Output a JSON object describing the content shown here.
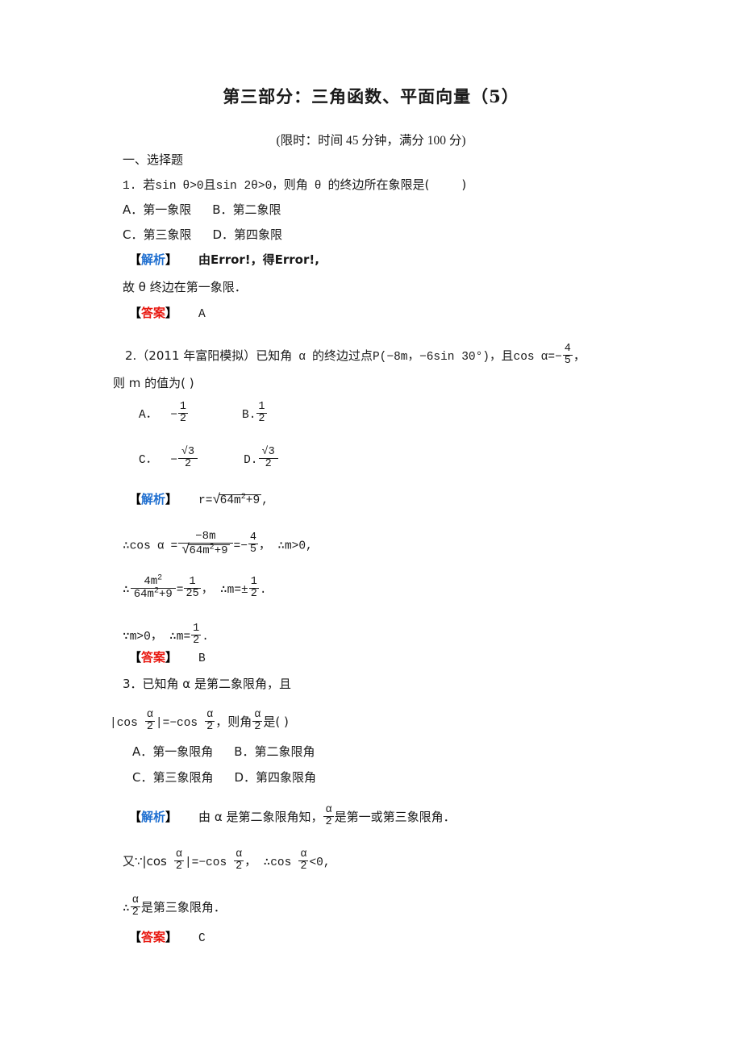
{
  "document": {
    "title": "第三部分：三角函数、平面向量（5）",
    "subtitle": "(限时：时间 45 分钟，满分 100 分)",
    "section_heading": "一、选择题",
    "labels": {
      "bracket_open": "【",
      "bracket_close": "】",
      "analysis": "解析",
      "answer": "答案"
    },
    "colors": {
      "analysis": "#1f6fd0",
      "answer": "#e8170f",
      "text": "#1a1a1a",
      "background": "#ffffff"
    }
  },
  "questions": [
    {
      "number": "1.",
      "stem": "若 sin θ>0 且 sin 2θ>0，则角 θ 的终边所在象限是(    )",
      "stem_parts": {
        "lead": "1.",
        "han1": "若",
        "expr1": "sin",
        "theta1": "θ",
        "gt1": ">0",
        "han2": "且",
        "expr2": "sin 2",
        "theta2": "θ",
        "gt2": ">0，",
        "han3": "则角",
        "theta3": "θ",
        "han4": "的终边所在象限是(",
        "tail": ")"
      },
      "options_row1": [
        "A．第一象限",
        "B．第二象限"
      ],
      "options_row2": [
        "C．第三象限",
        "D．第四象限"
      ],
      "analysis_lines": [
        {
          "lead": "由Error!，得Error!,"
        },
        {
          "lead": "故 θ 终边在第一象限．"
        }
      ],
      "answer": "A"
    },
    {
      "number": "2.",
      "stem_line1_a": "2.（2011 年富阳模拟）已知角",
      "stem_alpha": "α",
      "stem_line1_b": "的终边过点",
      "stem_point": "P(−8m，−6sin 30°)，",
      "stem_line1_c": "且",
      "stem_cos": "cos",
      "stem_alpha2": "α",
      "stem_eq": "=−",
      "stem_frac": {
        "num": "4",
        "den": "5"
      },
      "stem_comma": "，",
      "stem_line2": "则 m 的值为(    )",
      "options": [
        {
          "label": "A．",
          "sign": "−",
          "frac": {
            "num": "1",
            "den": "2"
          }
        },
        {
          "label": "B.",
          "sign": "",
          "frac": {
            "num": "1",
            "den": "2"
          }
        },
        {
          "label": "C．",
          "sign": "−",
          "frac": {
            "num": "√3",
            "den": "2"
          }
        },
        {
          "label": "D.",
          "sign": "",
          "frac": {
            "num": "√3",
            "den": "2"
          }
        }
      ],
      "analysis": {
        "line1": "r=√64m²+9,",
        "line2_pre": "∴cos",
        "line2_alpha": "α",
        "line2_eq": "=",
        "line2_frac": {
          "num": "−8m",
          "den": "√64m²+9"
        },
        "line2_eq2": "=−",
        "line2_frac2": {
          "num": "4",
          "den": "5"
        },
        "line2_tail": "，  ∴m>0,",
        "line3_pre": "∴",
        "line3_frac": {
          "num": "4m²",
          "den": "64m²+9"
        },
        "line3_eq": "=",
        "line3_frac2": {
          "num": "1",
          "den": "25"
        },
        "line3_mid": "，  ∴m=±",
        "line3_frac3": {
          "num": "1",
          "den": "2"
        },
        "line3_tail": ".",
        "line4_pre": "∵m>0，  ∴m=",
        "line4_frac": {
          "num": "1",
          "den": "2"
        },
        "line4_tail": "."
      },
      "answer": "B"
    },
    {
      "number": "3.",
      "stem_line1": "3．已知角 α 是第二象限角，且",
      "stem_line2": {
        "pre": "|cos",
        "frac1": {
          "num": "α",
          "den": "2"
        },
        "mid": "|=−cos",
        "frac2": {
          "num": "α",
          "den": "2"
        },
        "mid2": "，则角",
        "frac3": {
          "num": "α",
          "den": "2"
        },
        "tail": "是(    )"
      },
      "options_row1": [
        "A．第一象限角",
        "B．第二象限角"
      ],
      "options_row2": [
        "C．第三象限角",
        "D．第四象限角"
      ],
      "analysis": {
        "line1_pre": "由 α 是第二象限角知，",
        "line1_frac": {
          "num": "α",
          "den": "2"
        },
        "line1_tail": "是第一或第三象限角．",
        "line2_pre": "又∵|cos",
        "line2_frac1": {
          "num": "α",
          "den": "2"
        },
        "line2_mid": "|=−cos",
        "line2_frac2": {
          "num": "α",
          "den": "2"
        },
        "line2_mid2": "，  ∴cos",
        "line2_frac3": {
          "num": "α",
          "den": "2"
        },
        "line2_tail": "<0,",
        "line3_pre": "∴",
        "line3_frac": {
          "num": "α",
          "den": "2"
        },
        "line3_tail": "是第三象限角．"
      },
      "answer": "C"
    }
  ]
}
